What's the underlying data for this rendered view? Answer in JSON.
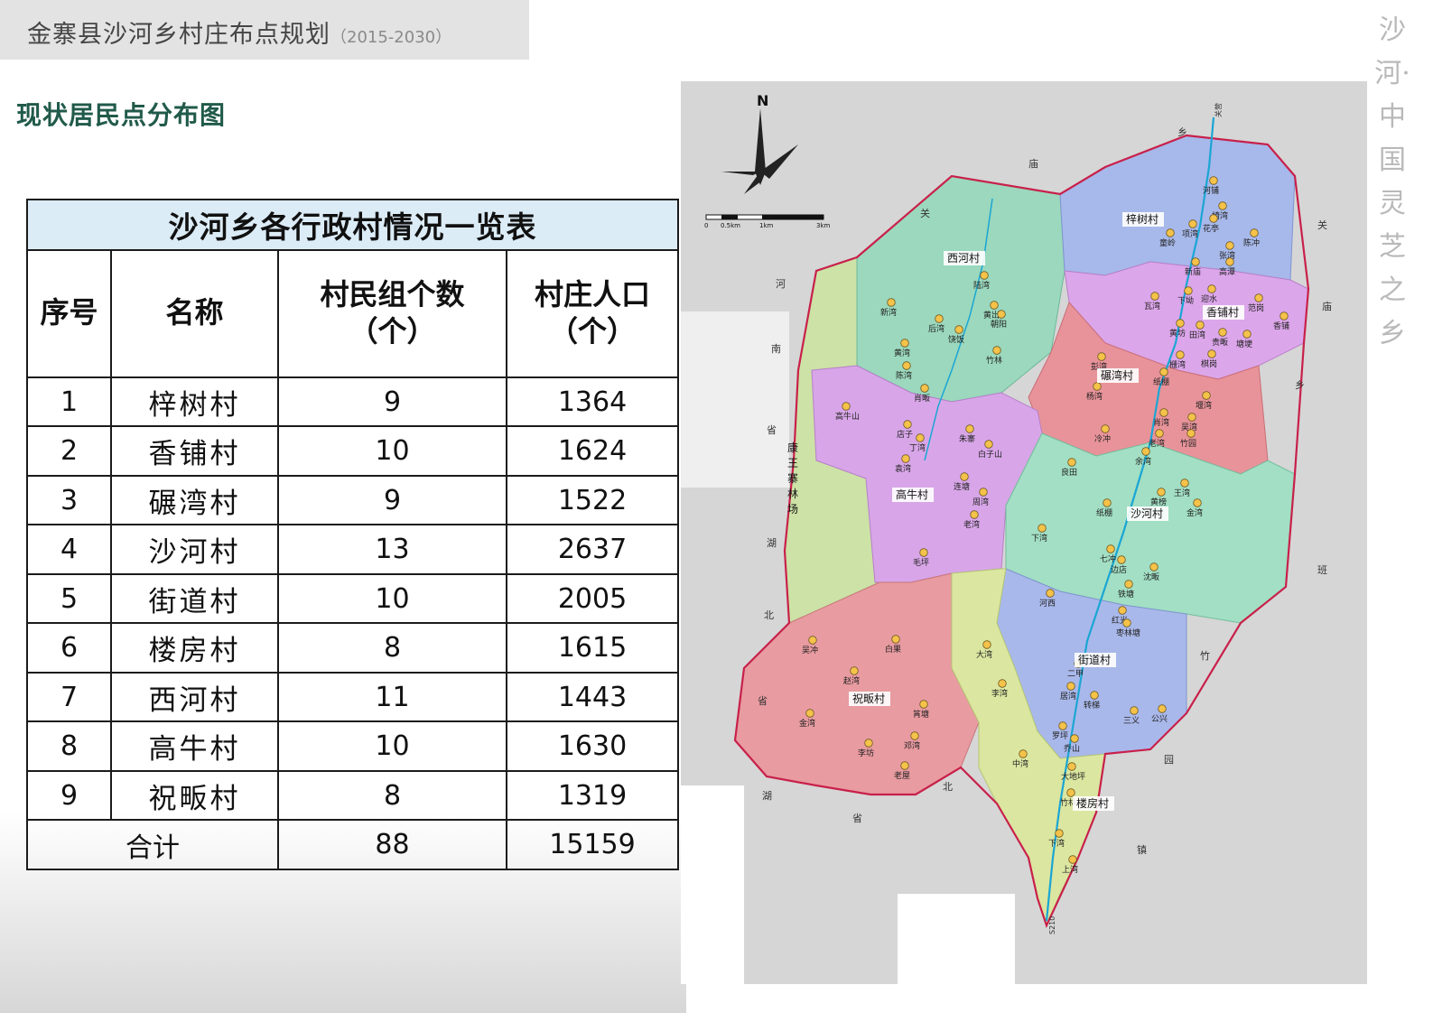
{
  "header": {
    "title": "金寨县沙河乡村庄布点规划",
    "years": "（2015-2030）"
  },
  "section_title": "现状居民点分布图",
  "table": {
    "caption": "沙河乡各行政村情况一览表",
    "headers": {
      "no": "序号",
      "name": "名称",
      "groups_line1": "村民组个数",
      "groups_line2": "（个）",
      "pop_line1": "村庄人口",
      "pop_line2": "（个）"
    },
    "rows": [
      {
        "no": "1",
        "name": "梓树村",
        "groups": "9",
        "population": "1364"
      },
      {
        "no": "2",
        "name": "香铺村",
        "groups": "10",
        "population": "1624"
      },
      {
        "no": "3",
        "name": "碾湾村",
        "groups": "9",
        "population": "1522"
      },
      {
        "no": "4",
        "name": "沙河村",
        "groups": "13",
        "population": "2637"
      },
      {
        "no": "5",
        "name": "街道村",
        "groups": "10",
        "population": "2005"
      },
      {
        "no": "6",
        "name": "楼房村",
        "groups": "8",
        "population": "1615"
      },
      {
        "no": "7",
        "name": "西河村",
        "groups": "11",
        "population": "1443"
      },
      {
        "no": "8",
        "name": "高牛村",
        "groups": "10",
        "population": "1630"
      },
      {
        "no": "9",
        "name": "祝畈村",
        "groups": "8",
        "population": "1319"
      }
    ],
    "total": {
      "label": "合计",
      "groups": "88",
      "population": "15159"
    }
  },
  "map": {
    "north_label": "N",
    "scale_labels": [
      "0",
      "0.5km",
      "1km",
      "3km"
    ],
    "villages": [
      "梓树村",
      "西河村",
      "香铺村",
      "碾湾村",
      "高牛村",
      "沙河村",
      "街道村",
      "祝畈村",
      "楼房村"
    ],
    "forest_label": "康王寨林场",
    "settlements": [
      "河铺",
      "椅湾",
      "花亭",
      "项湾",
      "陈冲",
      "童岭",
      "新庙",
      "高潭",
      "张湾",
      "瓦湾",
      "下坳",
      "迎水",
      "范岗",
      "香铺",
      "黄坊",
      "田湾",
      "贵畈",
      "塘埂",
      "栅湾",
      "棋岗",
      "彭湾",
      "纸棚",
      "杨湾",
      "堰湾",
      "肖湾",
      "吴湾",
      "老湾",
      "竹园",
      "后湾",
      "陆湾",
      "黄岀",
      "新湾",
      "朝阳",
      "黄湾",
      "饶饭",
      "竹林",
      "陈湾",
      "肖畈",
      "高牛山",
      "店子",
      "朱寨",
      "丁湾",
      "白子山",
      "袁湾",
      "连塘",
      "周湾",
      "老湾",
      "毛坪",
      "冷冲",
      "良田",
      "余湾",
      "纸棚",
      "黄榜",
      "王湾",
      "金湾",
      "下湾",
      "七冲",
      "边店",
      "沈畈",
      "铁塘",
      "河西",
      "红光",
      "枣林塘",
      "二甲",
      "三义",
      "转梯",
      "居湾",
      "罗坪",
      "公兴",
      "乔山",
      "吴冲",
      "白果",
      "赵湾",
      "金湾",
      "筲塘",
      "邓湾",
      "李坊",
      "老屋",
      "大湾",
      "李湾",
      "中湾",
      "大地坪",
      "竹林",
      "下湾",
      "上湾",
      "余坊"
    ],
    "border_labels": [
      "河",
      "南",
      "省",
      "湖",
      "北",
      "省",
      "湖",
      "北",
      "省",
      "关",
      "庙",
      "乡",
      "关",
      "庙",
      "乡",
      "班",
      "竹",
      "园",
      "镇"
    ],
    "road_labels": [
      "关营",
      "S210"
    ]
  },
  "decoration": "沙河·中国灵芝之乡"
}
